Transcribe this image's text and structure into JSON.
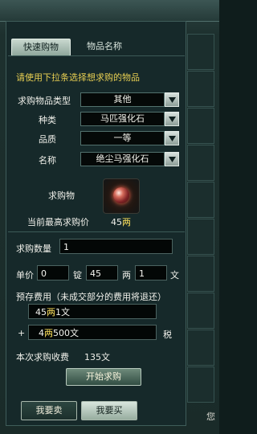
{
  "tabs": {
    "quick_buy": "快速购物",
    "item_name": "物品名称"
  },
  "hint": "请使用下拉条选择想求购的物品",
  "filters": [
    {
      "label": "求购物品类型",
      "value": "其他"
    },
    {
      "label": "种类",
      "value": "马匹强化石"
    },
    {
      "label": "品质",
      "value": "一等"
    },
    {
      "label": "名称",
      "value": "绝尘马强化石"
    }
  ],
  "item": {
    "label": "求购物",
    "max_price_label": "当前最高求购价",
    "max_price_value": "45",
    "max_price_unit": "两"
  },
  "quantity": {
    "label": "求购数量",
    "value": "1"
  },
  "unit_price": {
    "label": "单价",
    "ding": "0",
    "ding_unit": "锭",
    "liang": "45",
    "liang_unit": "两",
    "wen": "1",
    "wen_unit": "文"
  },
  "prepay": {
    "label": "预存费用（未成交部分的费用将退还）",
    "line1_num1": "45",
    "line1_unit1": "两",
    "line1_num2": "1",
    "line1_unit2": "文",
    "plus": "+",
    "line2_num1": "4",
    "line2_unit1": "两",
    "line2_num2": "500",
    "line2_unit2": "文",
    "tax": "税"
  },
  "fee": {
    "label": "本次求购收费",
    "value": "135文"
  },
  "buttons": {
    "start": "开始求购",
    "sell": "我要卖",
    "buy": "我要买"
  },
  "corner_text": "您"
}
